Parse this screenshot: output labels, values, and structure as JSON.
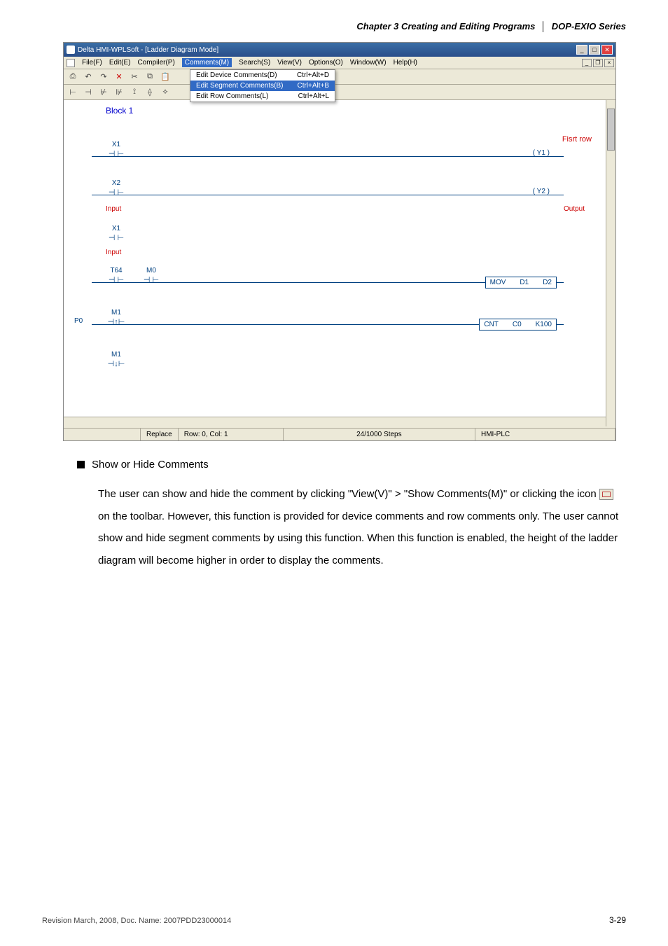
{
  "header": {
    "chapter": "Chapter 3 Creating and Editing Programs",
    "series": "DOP-EXIO Series"
  },
  "window": {
    "title": "Delta HMI-WPLSoft - [Ladder Diagram Mode]",
    "menu": [
      "File(F)",
      "Edit(E)",
      "Compiler(P)",
      "Comments(M)",
      "Search(S)",
      "View(V)",
      "Options(O)",
      "Window(W)",
      "Help(H)"
    ],
    "dropdown": [
      {
        "label": "Edit Device Comments(D)",
        "accel": "Ctrl+Alt+D",
        "selected": false
      },
      {
        "label": "Edit Segment Comments(B)",
        "accel": "Ctrl+Alt+B",
        "selected": true
      },
      {
        "label": "Edit Row Comments(L)",
        "accel": "Ctrl+Alt+L",
        "selected": false
      }
    ]
  },
  "ladder": {
    "block": "Block 1",
    "fisrt": "Fisrt row",
    "inputLabel": "Input",
    "outputLabel": "Output",
    "p0": "P0",
    "contacts": {
      "x1": "X1",
      "x2": "X2",
      "t64": "T64",
      "m0": "M0",
      "m1": "M1"
    },
    "coils": {
      "y1": "Y1",
      "y2": "Y2"
    },
    "mov": {
      "op": "MOV",
      "a": "D1",
      "b": "D2"
    },
    "cnt": {
      "op": "CNT",
      "a": "C0",
      "b": "K100"
    }
  },
  "status": {
    "mode": "Replace",
    "pos": "Row: 0, Col: 1",
    "steps": "24/1000 Steps",
    "target": "HMI-PLC"
  },
  "section": {
    "heading": "Show or Hide Comments",
    "body_part1": "The user can show and hide the comment by clicking \"View(V)\" > \"Show Comments(M)\" or clicking the icon ",
    "body_part2": " on the toolbar. However, this function is provided for device comments and row comments only. The user cannot show and hide segment comments by using this function. When this function is enabled, the height of the ladder diagram will become higher in order to display the comments."
  },
  "footer": {
    "left": "Revision March, 2008, Doc. Name: 2007PDD23000014",
    "right": "3-29"
  }
}
